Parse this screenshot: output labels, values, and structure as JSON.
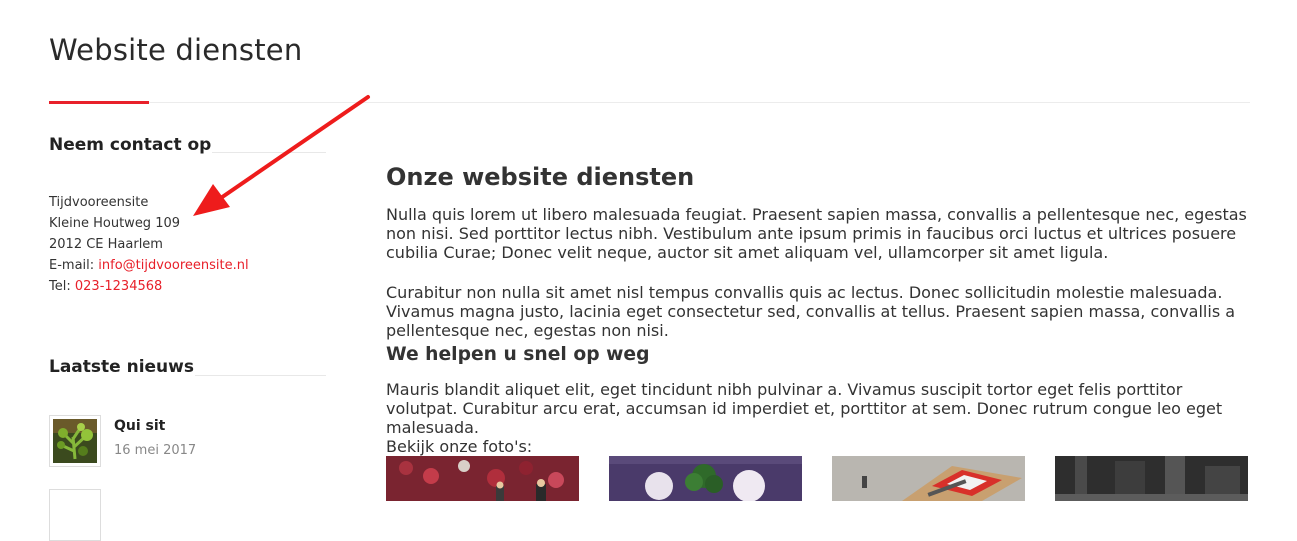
{
  "page": {
    "title": "Website diensten"
  },
  "sidebar": {
    "contact": {
      "title": "Neem contact op",
      "company": "Tijdvooreensite",
      "street": "Kleine Houtweg 109",
      "city": "2012 CE Haarlem",
      "email_label": "E-mail:",
      "email": "info@tijdvooreensite.nl",
      "phone_label": "Tel:",
      "phone": "023-1234568"
    },
    "news": {
      "title": "Laatste nieuws",
      "items": [
        {
          "title": "Qui sit",
          "date": "16 mei 2017"
        }
      ]
    }
  },
  "main": {
    "heading": "Onze website diensten",
    "paragraphs": [
      "Nulla quis lorem ut libero malesuada feugiat. Praesent sapien massa, convallis a pellentesque nec, egestas non nisi. Sed porttitor lectus nibh. Vestibulum ante ipsum primis in faucibus orci luctus et ultrices posuere cubilia Curae; Donec velit neque, auctor sit amet aliquam vel, ullamcorper sit amet ligula.",
      "Curabitur non nulla sit amet nisl tempus convallis quis ac lectus. Donec sollicitudin molestie malesuada. Vivamus magna justo, lacinia eget consectetur sed, convallis at tellus. Praesent sapien massa, convallis a pellentesque nec, egestas non nisi."
    ],
    "subheading": "We helpen u snel op weg",
    "paragraph3": "Mauris blandit aliquet elit, eget tincidunt nibh pulvinar a. Vivamus suscipit tortor eget felis porttitor volutpat. Curabitur arcu erat, accumsan id imperdiet et, porttitor at sem. Donec rutrum congue leo eget malesuada.",
    "photos_label": "Bekijk onze foto's:"
  },
  "colors": {
    "accent": "#e8202a",
    "annotation_arrow": "#ee1c1c"
  }
}
